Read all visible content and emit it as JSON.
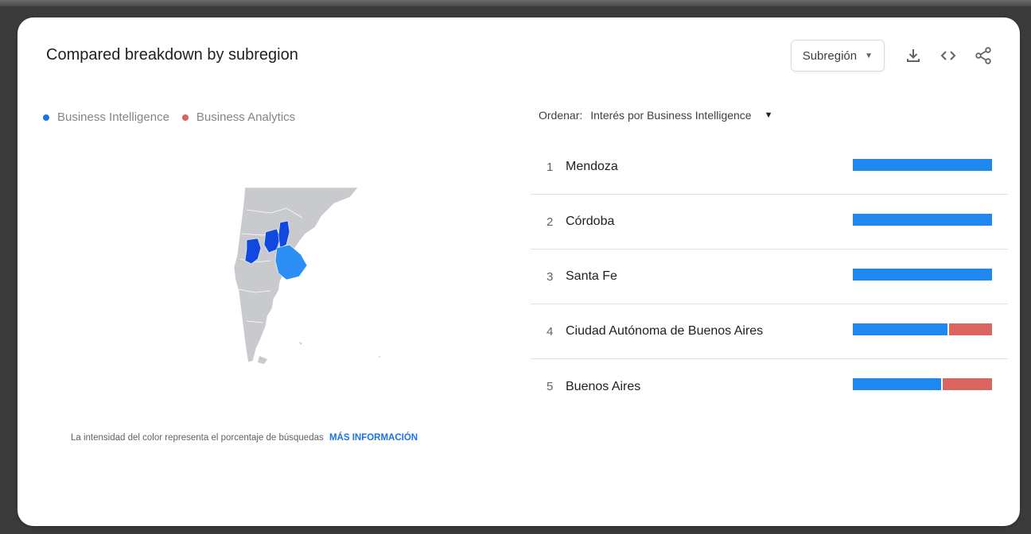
{
  "card": {
    "title": "Compared breakdown by subregion"
  },
  "toolbar": {
    "select_value": "Subregión",
    "icons": [
      "download-icon",
      "embed-code-icon",
      "share-icon"
    ]
  },
  "legend": [
    {
      "label": "Business Intelligence",
      "color": "#1a73e8"
    },
    {
      "label": "Business Analytics",
      "color": "#d96459"
    }
  ],
  "footnote": {
    "text": "La intensidad del color representa el porcentaje de búsquedas",
    "link": "MÁS INFORMACIÓN"
  },
  "sort": {
    "label": "Ordenar:",
    "value": "Interés por Business Intelligence"
  },
  "colors": {
    "series_a": "#1e88f0",
    "series_b": "#d9655e",
    "map_land": "#c8cacd",
    "map_highlight_dark": "#1149e0",
    "map_highlight_light": "#2d8ef5"
  },
  "ranking": [
    {
      "rank": "1",
      "name": "Mendoza",
      "share_a": 1.0,
      "share_b": 0.0
    },
    {
      "rank": "2",
      "name": "Córdoba",
      "share_a": 1.0,
      "share_b": 0.0
    },
    {
      "rank": "3",
      "name": "Santa Fe",
      "share_a": 1.0,
      "share_b": 0.0
    },
    {
      "rank": "4",
      "name": "Ciudad Autónoma de Buenos Aires",
      "share_a": 0.69,
      "share_b": 0.31
    },
    {
      "rank": "5",
      "name": "Buenos Aires",
      "share_a": 0.64,
      "share_b": 0.36
    }
  ]
}
